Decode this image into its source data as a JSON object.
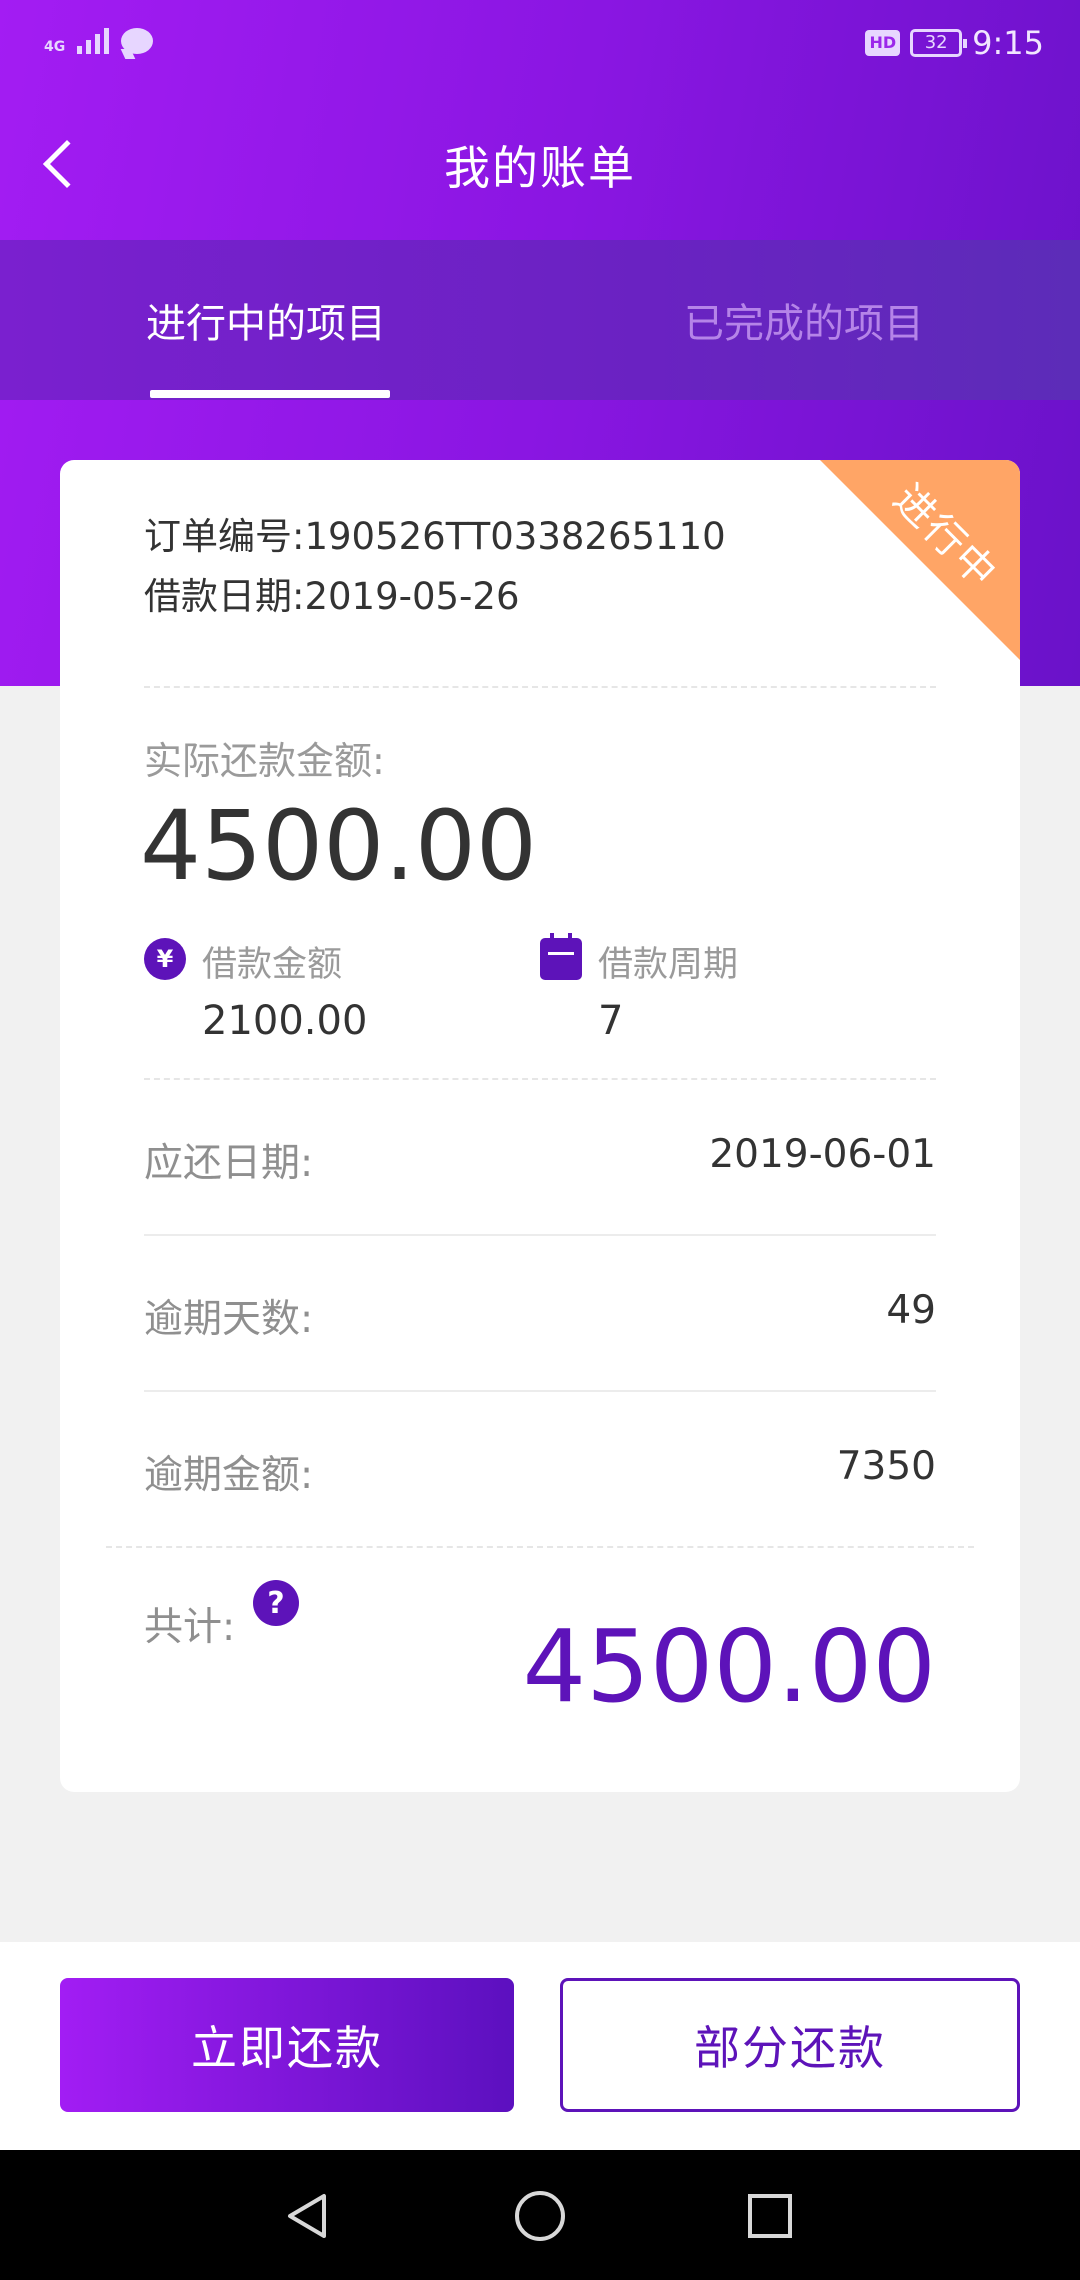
{
  "status_bar": {
    "network": "4G",
    "hd": "HD",
    "battery": "32",
    "time": "9:15"
  },
  "header": {
    "title": "我的账单",
    "back_icon": "chevron-left-icon"
  },
  "tabs": [
    {
      "label": "进行中的项目",
      "active": true
    },
    {
      "label": "已完成的项目",
      "active": false
    }
  ],
  "card": {
    "status_ribbon": "进行中",
    "order_number": "订单编号:190526TT0338265110",
    "loan_date": "借款日期:2019-05-26",
    "actual_repay_label": "实际还款金额:",
    "actual_repay_value": "4500.00",
    "loan_amount": {
      "icon": "yen-icon",
      "icon_glyph": "¥",
      "label": "借款金额",
      "value": "2100.00"
    },
    "loan_period": {
      "icon": "calendar-icon",
      "label": "借款周期",
      "value": "7"
    },
    "rows": [
      {
        "label": "应还日期:",
        "value": "2019-06-01"
      },
      {
        "label": "逾期天数:",
        "value": "49"
      },
      {
        "label": "逾期金额:",
        "value": "7350"
      }
    ],
    "total_label": "共计:",
    "help_glyph": "?",
    "total_value": "4500.00"
  },
  "actions": {
    "primary_label": "立即还款",
    "secondary_label": "部分还款"
  },
  "colors": {
    "brand_purple": "#5d13b9",
    "header_gradient_start": "#a31cf3",
    "header_gradient_end": "#6a12c9",
    "ribbon_orange": "#ffa566"
  }
}
